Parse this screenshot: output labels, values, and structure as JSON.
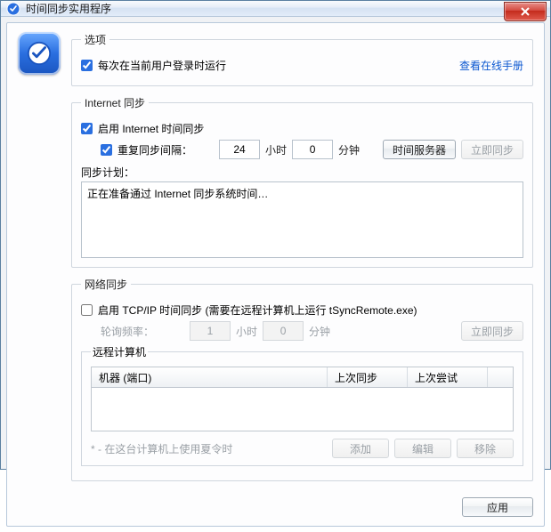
{
  "window": {
    "title": "时间同步实用程序"
  },
  "options": {
    "legend": "选项",
    "run_on_login_label": "每次在当前用户登录时运行",
    "manual_link": "查看在线手册"
  },
  "internet": {
    "legend": "Internet 同步",
    "enable_label": "启用 Internet 时间同步",
    "repeat_label": "重复同步间隔：",
    "hours_value": "24",
    "hours_unit": "小时",
    "minutes_value": "0",
    "minutes_unit": "分钟",
    "time_servers_btn": "时间服务器",
    "sync_now_btn": "立即同步",
    "plan_label": "同步计划：",
    "plan_text": "正在准备通过 Internet 同步系统时间…"
  },
  "network": {
    "legend": "网络同步",
    "enable_label": "启用 TCP/IP 时间同步 (需要在远程计算机上运行 tSyncRemote.exe)",
    "poll_label": "轮询频率：",
    "hours_value": "1",
    "hours_unit": "小时",
    "minutes_value": "0",
    "minutes_unit": "分钟",
    "sync_now_btn": "立即同步",
    "remote_legend": "远程计算机",
    "col_machine": "机器 (端口)",
    "col_last_sync": "上次同步",
    "col_last_try": "上次尝试",
    "dst_hint": "* - 在这台计算机上使用夏令时",
    "add_btn": "添加",
    "edit_btn": "编辑",
    "remove_btn": "移除"
  },
  "apply_btn": "应用"
}
